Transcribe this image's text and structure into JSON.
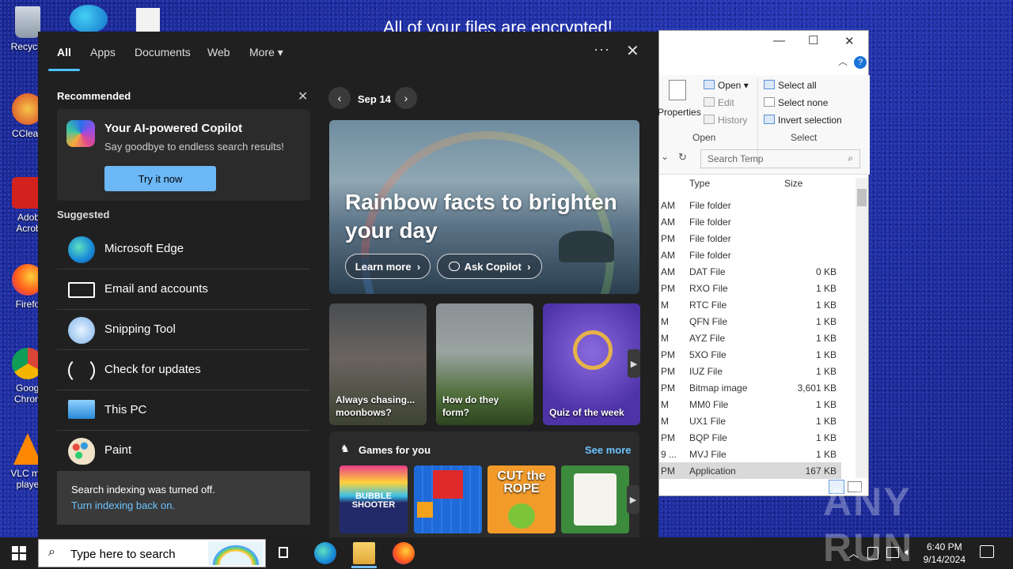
{
  "desktop": {
    "icons": [
      {
        "label": "Recycle",
        "icon": "recycle-bin-icon"
      },
      {
        "label": "CClean",
        "icon": "ccleaner-icon"
      },
      {
        "label": "Adob Acrob",
        "icon": "acrobat-icon"
      },
      {
        "label": "Firefo",
        "icon": "firefox-icon"
      },
      {
        "label": "Googl Chrom",
        "icon": "chrome-icon"
      },
      {
        "label": "VLC me playe",
        "icon": "vlc-icon"
      }
    ],
    "ransom_text": "All of your files are encrypted!",
    "watermark": "ANY RUN"
  },
  "explorer": {
    "ribbon": {
      "properties": "Properties",
      "open": "Open",
      "edit": "Edit",
      "history": "History",
      "select_all": "Select all",
      "select_none": "Select none",
      "invert_selection": "Invert selection",
      "group_open": "Open",
      "group_select": "Select"
    },
    "search_placeholder": "Search Temp",
    "columns": {
      "type": "Type",
      "size": "Size"
    },
    "rows": [
      {
        "time": "AM",
        "type": "File folder",
        "size": ""
      },
      {
        "time": "AM",
        "type": "File folder",
        "size": ""
      },
      {
        "time": "PM",
        "type": "File folder",
        "size": ""
      },
      {
        "time": "AM",
        "type": "File folder",
        "size": ""
      },
      {
        "time": "AM",
        "type": "DAT File",
        "size": "0 KB"
      },
      {
        "time": "PM",
        "type": "RXO File",
        "size": "1 KB"
      },
      {
        "time": "M",
        "type": "RTC File",
        "size": "1 KB"
      },
      {
        "time": "M",
        "type": "QFN File",
        "size": "1 KB"
      },
      {
        "time": "M",
        "type": "AYZ File",
        "size": "1 KB"
      },
      {
        "time": "PM",
        "type": "5XO File",
        "size": "1 KB"
      },
      {
        "time": "PM",
        "type": "IUZ File",
        "size": "1 KB"
      },
      {
        "time": "PM",
        "type": "Bitmap image",
        "size": "3,601 KB"
      },
      {
        "time": "M",
        "type": "MM0 File",
        "size": "1 KB"
      },
      {
        "time": "M",
        "type": "UX1 File",
        "size": "1 KB"
      },
      {
        "time": "PM",
        "type": "BQP File",
        "size": "1 KB"
      },
      {
        "time": "9 ...",
        "type": "MVJ File",
        "size": "1 KB"
      },
      {
        "time": "PM",
        "type": "Application",
        "size": "167 KB"
      }
    ]
  },
  "search": {
    "tabs": [
      "All",
      "Apps",
      "Documents",
      "Web",
      "More"
    ],
    "more_icon": "ellipsis-icon",
    "recommended": {
      "title": "Recommended",
      "card_title": "Your AI-powered Copilot",
      "card_subtitle": "Say goodbye to endless search results!",
      "button": "Try it now"
    },
    "suggested": {
      "title": "Suggested",
      "items": [
        {
          "label": "Microsoft Edge",
          "icon": "edge-icon"
        },
        {
          "label": "Email and accounts",
          "icon": "mail-icon"
        },
        {
          "label": "Snipping Tool",
          "icon": "snipping-tool-icon"
        },
        {
          "label": "Check for updates",
          "icon": "refresh-icon"
        },
        {
          "label": "This PC",
          "icon": "computer-icon"
        },
        {
          "label": "Paint",
          "icon": "paint-icon"
        }
      ]
    },
    "notice": {
      "text": "Search indexing was turned off.",
      "link": "Turn indexing back on."
    },
    "highlights": {
      "date": "Sep 14",
      "hero_title": "Rainbow facts to brighten your day",
      "learn_more": "Learn more",
      "ask_copilot": "Ask Copilot",
      "tiles": [
        {
          "caption": "Always chasing... moonbows?"
        },
        {
          "caption": "How do they form?"
        },
        {
          "caption": "Quiz of the week"
        }
      ],
      "games_title": "Games for you",
      "see_more": "See more",
      "games": [
        "BUBBLE SHOOTER",
        "Blocks",
        "CUT the ROPE",
        "Mahjong"
      ]
    }
  },
  "taskbar": {
    "search_placeholder": "Type here to search",
    "time": "6:40 PM",
    "date": "9/14/2024"
  }
}
